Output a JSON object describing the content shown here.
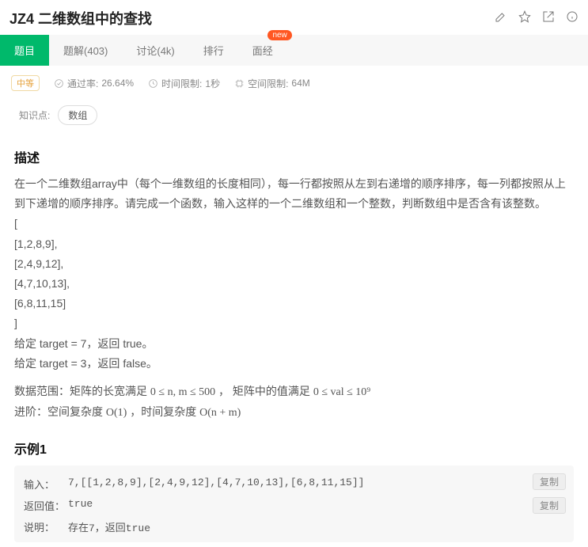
{
  "header": {
    "title": "JZ4 二维数组中的查找"
  },
  "tabs": {
    "problem": "题目",
    "solution": "题解(403)",
    "discussion": "讨论(4k)",
    "rank": "排行",
    "interview": "面经",
    "interview_badge": "new"
  },
  "meta": {
    "difficulty": "中等",
    "pass_label": "通过率:",
    "pass_value": "26.64%",
    "time_label": "时间限制:",
    "time_value": "1秒",
    "mem_label": "空间限制:",
    "mem_value": "64M"
  },
  "knowledge": {
    "label": "知识点:",
    "tags": [
      "数组"
    ]
  },
  "description": {
    "heading": "描述",
    "paragraph": "在一个二维数组array中（每个一维数组的长度相同），每一行都按照从左到右递增的顺序排序，每一列都按照从上到下递增的顺序排序。请完成一个函数，输入这样的一个二维数组和一个整数，判断数组中是否含有该整数。",
    "matrix_lines": [
      "[",
      "[1,2,8,9],",
      "[2,4,9,12],",
      "[4,7,10,13],",
      "[6,8,11,15]",
      "]"
    ],
    "target_true": "给定 target = 7，返回 true。",
    "target_false": "给定 target = 3，返回 false。",
    "range_pre": "数据范围：矩阵的长宽满足 ",
    "range_f1": "0 ≤ n, m ≤ 500",
    "range_mid": " ， 矩阵中的值满足 ",
    "range_f2": "0 ≤ val ≤ 10⁹",
    "advance_pre": "进阶：空间复杂度 ",
    "advance_f1": "O(1)",
    "advance_mid": " ，时间复杂度 ",
    "advance_f2": "O(n + m)"
  },
  "example1": {
    "heading": "示例1",
    "input_label": "输入：",
    "input_value": "7,[[1,2,8,9],[2,4,9,12],[4,7,10,13],[6,8,11,15]]",
    "return_label": "返回值：",
    "return_value": "true",
    "explain_label": "说明：",
    "explain_value": "存在7，返回true",
    "copy": "复制"
  }
}
